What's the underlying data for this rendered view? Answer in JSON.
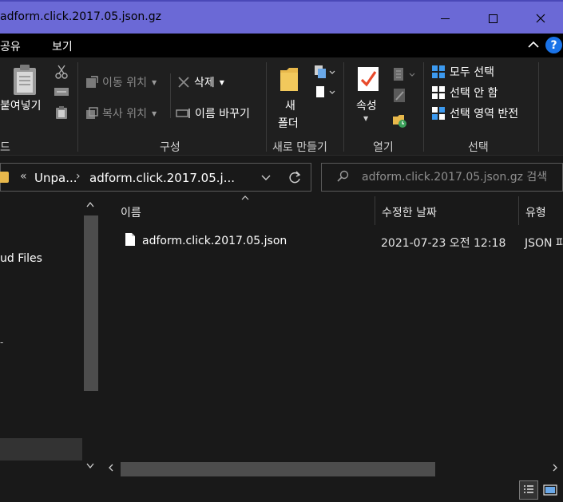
{
  "window": {
    "title": "adform.click.2017.05.json.gz"
  },
  "menu": {
    "tabs": [
      "공유",
      "보기"
    ],
    "help": "?"
  },
  "ribbon": {
    "clipboard": {
      "paste_label": "붙여넣기",
      "group_label": "드"
    },
    "organize": {
      "move_to": "이동 위치",
      "copy_to": "복사 위치",
      "delete": "삭제",
      "rename": "이름 바꾸기",
      "group_label": "구성"
    },
    "new": {
      "new_folder_line1": "새",
      "new_folder_line2": "폴더",
      "group_label": "새로 만들기"
    },
    "open": {
      "properties": "속성",
      "group_label": "열기"
    },
    "select": {
      "select_all": "모두 선택",
      "select_none": "선택 안 함",
      "invert_selection": "선택 영역 반전",
      "group_label": "선택"
    }
  },
  "address": {
    "overflow": "«",
    "crumbs": [
      "Unpa...",
      "adform.click.2017.05.j..."
    ]
  },
  "search": {
    "placeholder": "adform.click.2017.05.json.gz 검색"
  },
  "nav": {
    "cloud_item": "ud Files",
    "tick": "-"
  },
  "columns": {
    "name": "이름",
    "date": "수정한 날짜",
    "type": "유형"
  },
  "files": [
    {
      "name": "adform.click.2017.05.json",
      "date": "2021-07-23 오전 12:18",
      "type": "JSON 파"
    }
  ],
  "colors": {
    "titlebar": "#6b69d6",
    "accent_blue": "#1a73e8",
    "folder": "#e8b84b"
  },
  "icons": {
    "min": "minimize-icon",
    "max": "maximize-icon",
    "close": "close-icon"
  }
}
